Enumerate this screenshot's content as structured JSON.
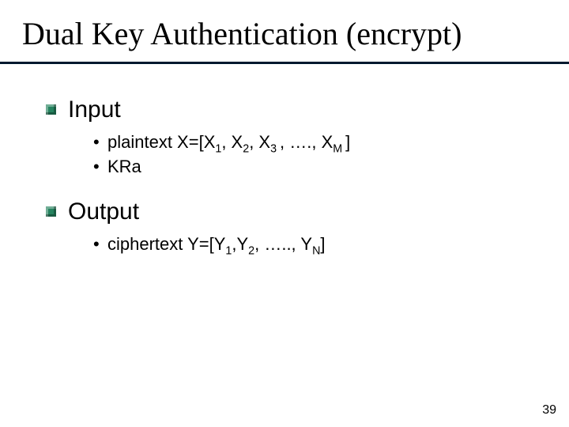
{
  "title": "Dual Key Authentication (encrypt)",
  "sections": [
    {
      "heading": "Input",
      "items": [
        {
          "prefix": "plaintext X=[X",
          "s1": "1",
          "t1": ", X",
          "s2": "2",
          "t2": ",  X",
          "s3": "3 ",
          "t3": ", …., X",
          "s4": "M ",
          "t4": "]"
        },
        {
          "plain": "KRa"
        }
      ]
    },
    {
      "heading": "Output",
      "items": [
        {
          "prefix": "ciphertext Y=[Y",
          "s1": "1",
          "t1": ",Y",
          "s2": "2",
          "t2": ", ….., Y",
          "s3": "N",
          "t3": "]"
        }
      ]
    }
  ],
  "page_number": "39"
}
